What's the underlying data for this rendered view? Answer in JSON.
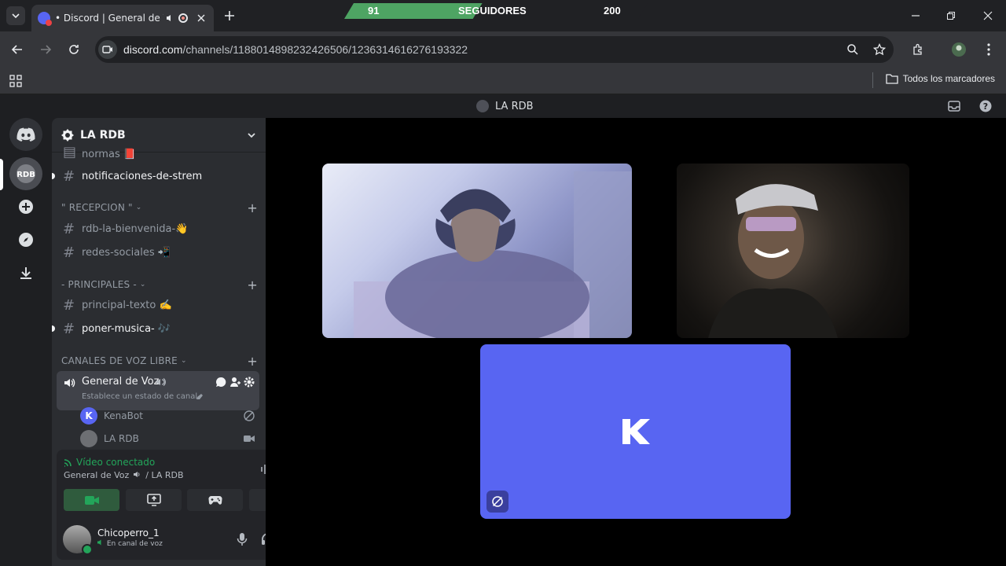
{
  "browser": {
    "tab_title": "• Discord | General de Voz",
    "url_host": "discord.com",
    "url_path": "/channels/1188014898232426506/1236314616276193322",
    "bookmarks_label": "Todos los marcadores"
  },
  "followers_overlay": {
    "current": "91",
    "label": "SEGUIDORES",
    "goal": "200",
    "progress_fraction": 0.455
  },
  "discord": {
    "title_server": "LA RDB",
    "server_name": "LA RDB",
    "channels_top": [
      {
        "name": "normas 📕"
      },
      {
        "name": "notificaciones-de-strem"
      }
    ],
    "categories": [
      {
        "label": "\" RECEPCION \""
      },
      {
        "label": "- PRINCIPALES -"
      },
      {
        "label": "CANALES DE VOZ LIBRE"
      }
    ],
    "recepcion_channels": [
      "rdb-la-bienvenida-👋",
      "redes-sociales 📲"
    ],
    "principales_channels": [
      "principal-texto ✍️",
      "poner-musica- 🎶"
    ],
    "voice_channel": {
      "name": "General de Voz",
      "status_placeholder": "Establece un estado de canal"
    },
    "voice_members": [
      "KenaBot",
      "LA RDB"
    ],
    "voice_panel": {
      "status": "Vídeo conectado",
      "location": "General de Voz",
      "location_server": "/ LA RDB"
    },
    "user": {
      "name": "Chicoperro_1",
      "status": "En canal de voz"
    }
  },
  "colors": {
    "blurple": "#5865f2",
    "green": "#23a55a",
    "sidebar": "#2b2d31",
    "overlay_green": "#4ea463"
  }
}
